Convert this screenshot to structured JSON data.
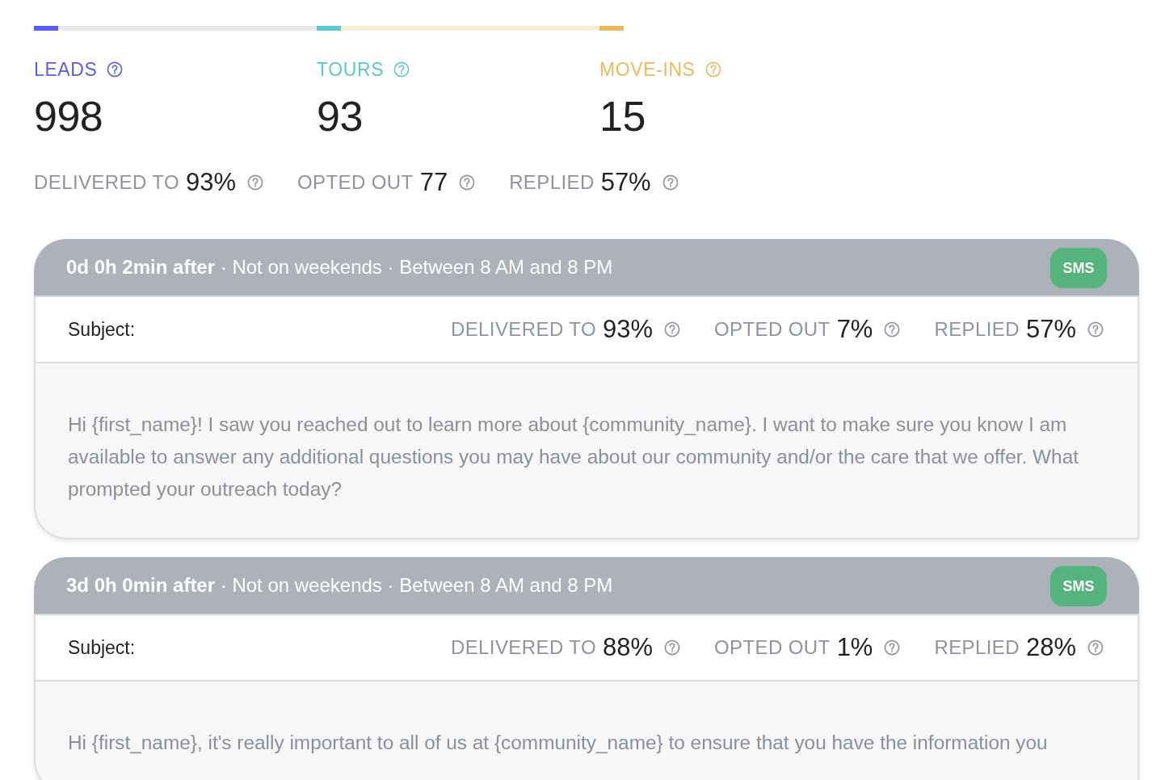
{
  "funnel": [
    {
      "label": "LEADS",
      "value": "998",
      "color": "#5b5cf0",
      "level": 0.086,
      "track": {
        "color": "#e6e7eb"
      }
    },
    {
      "label": "TOURS",
      "value": "93",
      "color": "#5ec9cb",
      "level": 0.086,
      "track": {
        "color": "#fbecd2"
      }
    },
    {
      "label": "MOVE-INS",
      "value": "15",
      "color": "#ecb95f",
      "level": 1
    }
  ],
  "summary": [
    {
      "label": "DELIVERED TO",
      "value": "93%"
    },
    {
      "label": "OPTED OUT",
      "value": "77"
    },
    {
      "label": "REPLIED",
      "value": "57%"
    }
  ],
  "messages": [
    {
      "schedule": "**0d 0h 2min after** · Not on weekends · Between 8 AM and 8 PM",
      "channel": "SMS",
      "subject_label": "Subject:",
      "stats": [
        {
          "label": "DELIVERED TO",
          "value": "93%"
        },
        {
          "label": "OPTED OUT",
          "value": "7%"
        },
        {
          "label": "REPLIED",
          "value": "57%"
        }
      ],
      "body": "Hi {first_name}! I saw you reached out to learn more about {community_name}. I want to make sure you know I am available to answer any additional questions you may have about our community and/or the care that we offer. What prompted your outreach today?"
    },
    {
      "schedule": "**3d 0h 0min after** · Not on weekends · Between 8 AM and 8 PM",
      "channel": "SMS",
      "subject_label": "Subject:",
      "stats": [
        {
          "label": "DELIVERED TO",
          "value": "88%"
        },
        {
          "label": "OPTED OUT",
          "value": "1%"
        },
        {
          "label": "REPLIED",
          "value": "28%"
        }
      ],
      "body": "Hi {first_name}, it's really important to all of us at {community_name} to ensure that you have the information you"
    }
  ]
}
